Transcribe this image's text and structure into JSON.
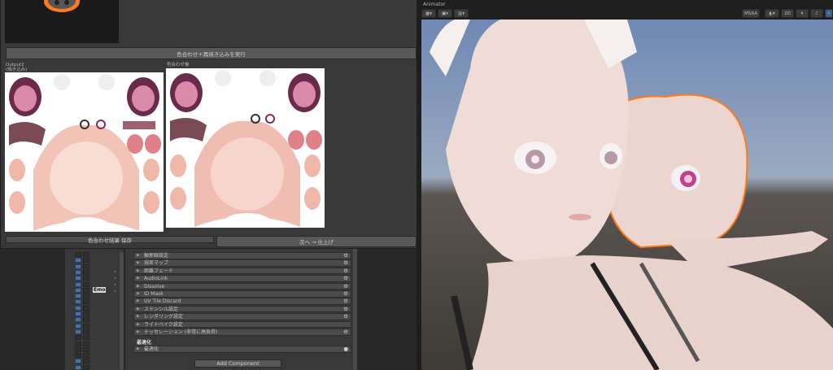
{
  "popup": {
    "run_button": "色合わせ＋再焼き込みを実行",
    "output_label_line1": "Output2",
    "output_label_line2": "(焼き込み)",
    "matched_label": "色合わせ後",
    "save_button": "色合わせ結果 保存",
    "next_button": "次へ → 仕上げ"
  },
  "hierarchy": {
    "selected_label": "Emo"
  },
  "inspector": {
    "rows": [
      "輪郭線設定",
      "視差マップ",
      "距離フェード",
      "AudioLink",
      "Dissolve",
      "ID Mask",
      "UV Tile Discard",
      "ステンシル設定",
      "レンダリング設定",
      "ライトベイク設定",
      "テッセレーション (非常に高負荷)"
    ],
    "optimize_header": "最適化",
    "optimize_row": "最適化",
    "add_component": "Add Component"
  },
  "scene": {
    "title": "Animator",
    "toolbar_right": [
      "MSAA",
      "2D"
    ],
    "sky_color": "#6f88b3",
    "ground_color": "#4a4540",
    "outline_color": "#ff7a1a"
  }
}
